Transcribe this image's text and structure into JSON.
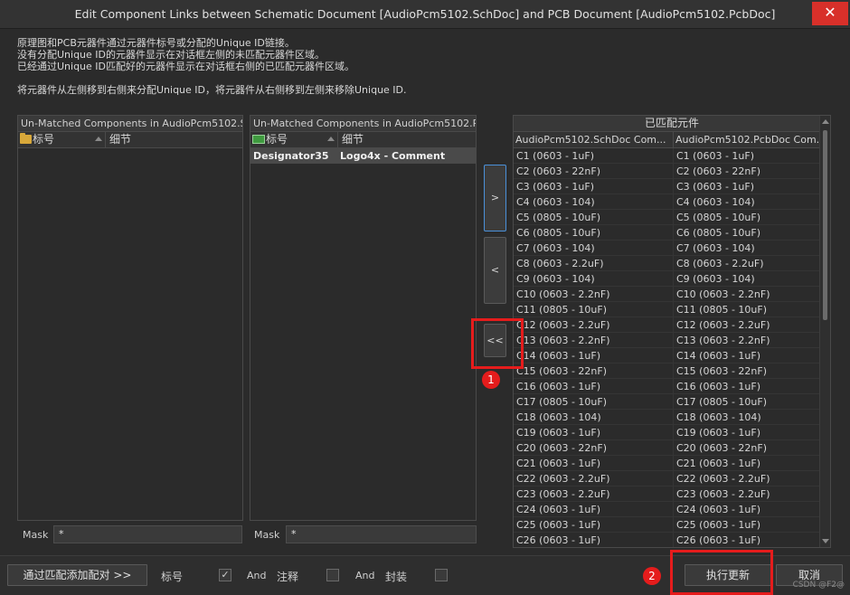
{
  "window": {
    "title": "Edit Component Links between Schematic Document [AudioPcm5102.SchDoc] and PCB Document [AudioPcm5102.PcbDoc]",
    "close_glyph": "✕"
  },
  "info": {
    "line1": "原理图和PCB元器件通过元器件标号或分配的Unique ID链接。",
    "line2": "没有分配Unique ID的元器件显示在对话框左侧的未匹配元器件区域。",
    "line3": "已经通过Unique ID匹配好的元器件显示在对话框右侧的已匹配元器件区域。",
    "note": "将元器件从左侧移到右侧来分配Unique ID，将元器件从右侧移到左侧来移除Unique ID."
  },
  "left_panel": {
    "header": "Un-Matched Components in AudioPcm5102.S...",
    "col_designator": "标号",
    "col_detail": "细节",
    "icon": "folder-icon",
    "rows": []
  },
  "mid_panel": {
    "header": "Un-Matched Components in AudioPcm5102.P...",
    "col_designator": "标号",
    "col_detail": "细节",
    "icon": "chip-icon",
    "rows": [
      {
        "designator": "Designator35",
        "detail": "Logo4x - Comment"
      }
    ]
  },
  "move_buttons": {
    "add": ">",
    "remove": "<",
    "remove_all": "<<"
  },
  "matched_panel": {
    "header": "已匹配元件",
    "col_sch": "AudioPcm5102.SchDoc Com...",
    "col_pcb": "AudioPcm5102.PcbDoc Com...",
    "rows": [
      {
        "sch": "C1 (0603 - 1uF)",
        "pcb": "C1 (0603 - 1uF)"
      },
      {
        "sch": "C2 (0603 - 22nF)",
        "pcb": "C2 (0603 - 22nF)"
      },
      {
        "sch": "C3 (0603 - 1uF)",
        "pcb": "C3 (0603 - 1uF)"
      },
      {
        "sch": "C4 (0603 - 104)",
        "pcb": "C4 (0603 - 104)"
      },
      {
        "sch": "C5 (0805 - 10uF)",
        "pcb": "C5 (0805 - 10uF)"
      },
      {
        "sch": "C6 (0805 - 10uF)",
        "pcb": "C6 (0805 - 10uF)"
      },
      {
        "sch": "C7 (0603 - 104)",
        "pcb": "C7 (0603 - 104)"
      },
      {
        "sch": "C8 (0603 - 2.2uF)",
        "pcb": "C8 (0603 - 2.2uF)"
      },
      {
        "sch": "C9 (0603 - 104)",
        "pcb": "C9 (0603 - 104)"
      },
      {
        "sch": "C10 (0603 - 2.2nF)",
        "pcb": "C10 (0603 - 2.2nF)"
      },
      {
        "sch": "C11 (0805 - 10uF)",
        "pcb": "C11 (0805 - 10uF)"
      },
      {
        "sch": "C12 (0603 - 2.2uF)",
        "pcb": "C12 (0603 - 2.2uF)"
      },
      {
        "sch": "C13 (0603 - 2.2nF)",
        "pcb": "C13 (0603 - 2.2nF)"
      },
      {
        "sch": "C14 (0603 - 1uF)",
        "pcb": "C14 (0603 - 1uF)"
      },
      {
        "sch": "C15 (0603 - 22nF)",
        "pcb": "C15 (0603 - 22nF)"
      },
      {
        "sch": "C16 (0603 - 1uF)",
        "pcb": "C16 (0603 - 1uF)"
      },
      {
        "sch": "C17 (0805 - 10uF)",
        "pcb": "C17 (0805 - 10uF)"
      },
      {
        "sch": "C18 (0603 - 104)",
        "pcb": "C18 (0603 - 104)"
      },
      {
        "sch": "C19 (0603 - 1uF)",
        "pcb": "C19 (0603 - 1uF)"
      },
      {
        "sch": "C20 (0603 - 22nF)",
        "pcb": "C20 (0603 - 22nF)"
      },
      {
        "sch": "C21 (0603 - 1uF)",
        "pcb": "C21 (0603 - 1uF)"
      },
      {
        "sch": "C22 (0603 - 2.2uF)",
        "pcb": "C22 (0603 - 2.2uF)"
      },
      {
        "sch": "C23 (0603 - 2.2uF)",
        "pcb": "C23 (0603 - 2.2uF)"
      },
      {
        "sch": "C24 (0603 - 1uF)",
        "pcb": "C24 (0603 - 1uF)"
      },
      {
        "sch": "C25 (0603 - 1uF)",
        "pcb": "C25 (0603 - 1uF)"
      },
      {
        "sch": "C26 (0603 - 1uF)",
        "pcb": "C26 (0603 - 1uF)"
      }
    ]
  },
  "mask": {
    "label": "Mask",
    "left_value": "*",
    "mid_value": "*"
  },
  "bottom": {
    "add_matched_button": "通过匹配添加配对 >>",
    "designator_label": "标号",
    "designator_checked": "✓",
    "and1": "And",
    "comment_label": "注释",
    "and2": "And",
    "footprint_label": "封装",
    "execute_button": "执行更新",
    "cancel_button": "取消"
  },
  "annotations": {
    "badge1": "1",
    "badge2": "2",
    "highlight_color": "#e51c1c"
  },
  "watermark": "CSDN @F2@"
}
